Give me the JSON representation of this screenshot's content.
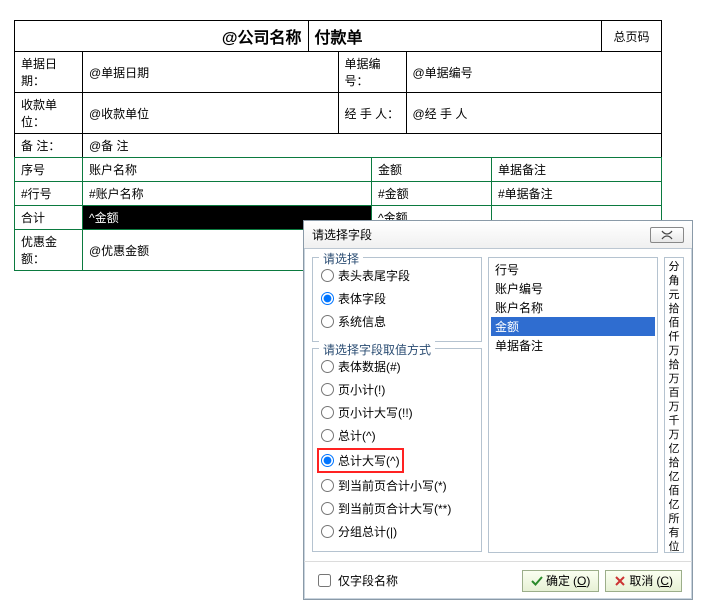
{
  "doc": {
    "title_company": "@公司名称",
    "title_name": "付款单",
    "page_code": "总页码",
    "info": {
      "date_lbl": "单据日期：",
      "date_val": "@单据日期",
      "no_lbl": "单据编号：",
      "no_val": "@单据编号",
      "payee_lbl": "收款单位：",
      "payee_val": "@收款单位",
      "handler_lbl": "经 手 人：",
      "handler_val": "@经 手 人",
      "remark_lbl": "备    注：",
      "remark_val": "@备    注"
    },
    "cols": {
      "seq": "序号",
      "acct": "账户名称",
      "amt": "金额",
      "rem": "单据备注"
    },
    "row": {
      "seq": "#行号",
      "acct": "#账户名称",
      "amt": "#金额",
      "rem": "#单据备注"
    },
    "total": {
      "lbl": "合计",
      "amt_cap": "^金额",
      "amt": "^金额"
    },
    "discount": {
      "lbl": "优惠金额：",
      "val": "@优惠金额"
    }
  },
  "dialog": {
    "title": "请选择字段",
    "close": "✕",
    "group1": {
      "legend": "请选择",
      "opt1": "表头表尾字段",
      "opt2": "表体字段",
      "opt3": "系统信息"
    },
    "group2": {
      "legend": "请选择字段取值方式",
      "o1": "表体数据(#)",
      "o2": "页小计(!)",
      "o3": "页小计大写(!!)",
      "o4": "总计(^)",
      "o5": "总计大写(^)",
      "o6": "到当前页合计小写(*)",
      "o7": "到当前页合计大写(**)",
      "o8": "分组总计(|)"
    },
    "fields": [
      "行号",
      "账户编号",
      "账户名称",
      "金额",
      "单据备注"
    ],
    "selected_field_index": 3,
    "rightcol": [
      "分",
      "角",
      "元",
      "拾",
      "佰",
      "仟",
      "万",
      "拾万",
      "百万",
      "千万",
      "亿",
      "拾亿",
      "佰亿",
      "所有位"
    ],
    "chk_label": "仅字段名称",
    "ok": "确定",
    "ok_key": "O",
    "cancel": "取消",
    "cancel_key": "C"
  }
}
